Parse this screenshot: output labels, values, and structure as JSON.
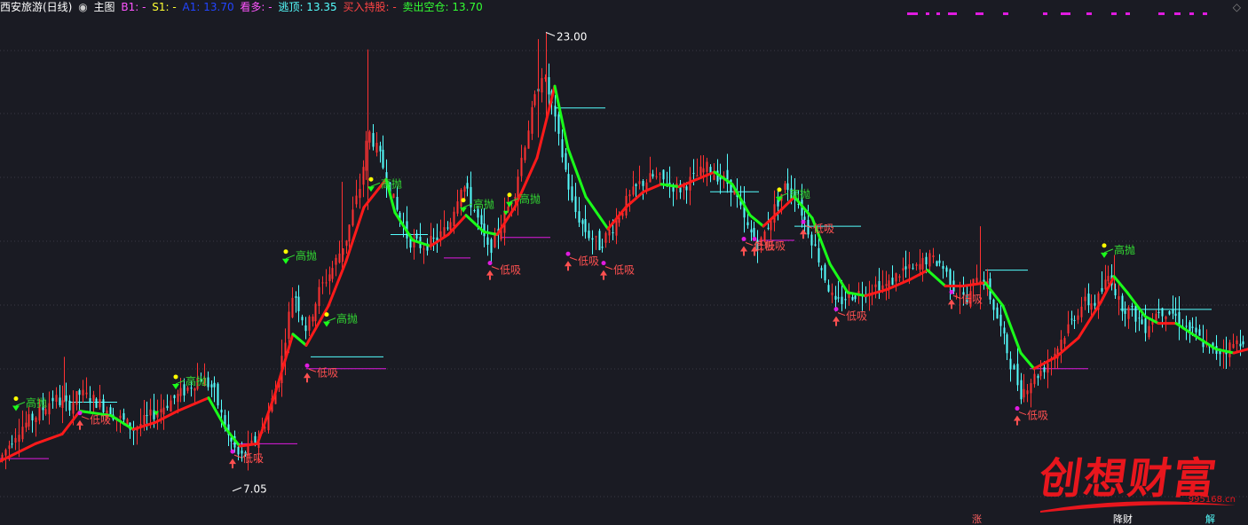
{
  "header": {
    "stock_name": "西安旅游(日线)",
    "main_label": "主图",
    "b1_label": "B1: -",
    "s1_label": "S1: -",
    "a_label": "A1: 13.70",
    "look_up_label": "看多: -",
    "escape_top_label": "逃顶: 13.35",
    "buy_hold_label": "买入持股: -",
    "sell_empty_label": "卖出空仓: 13.70"
  },
  "colors": {
    "background": "#1a1b23",
    "up": "#ff3232",
    "down": "#54ffff",
    "line_up": "#ff1a1a",
    "line_down": "#1aff1a",
    "sell_label": "#33dd33",
    "buy_label": "#ff5050",
    "magenta": "#e01be0",
    "yellow": "#ffff00",
    "grid": "#3a3a44"
  },
  "chart_data": {
    "type": "candlestick",
    "ylim": [
      6.5,
      24.0
    ],
    "y_scale": "log",
    "high_label": "23.00",
    "low_label": "7.05",
    "sell_signal_text": "高抛",
    "buy_signal_text": "低吸",
    "anchors": [
      [
        0,
        7.6
      ],
      [
        20,
        8.2
      ],
      [
        40,
        8.5
      ],
      [
        60,
        8.9
      ],
      [
        75,
        8.7
      ],
      [
        90,
        9.0
      ],
      [
        110,
        8.8
      ],
      [
        130,
        8.5
      ],
      [
        150,
        8.2
      ],
      [
        170,
        8.5
      ],
      [
        190,
        8.8
      ],
      [
        210,
        9.1
      ],
      [
        225,
        9.4
      ],
      [
        240,
        9.1
      ],
      [
        255,
        8.1
      ],
      [
        270,
        7.6
      ],
      [
        285,
        7.9
      ],
      [
        300,
        8.4
      ],
      [
        315,
        9.5
      ],
      [
        330,
        11.8
      ],
      [
        345,
        10.6
      ],
      [
        360,
        11.8
      ],
      [
        375,
        12.5
      ],
      [
        390,
        13.5
      ],
      [
        405,
        15.4
      ],
      [
        415,
        17.8
      ],
      [
        430,
        16.4
      ],
      [
        445,
        14.6
      ],
      [
        460,
        13.4
      ],
      [
        475,
        13.2
      ],
      [
        490,
        13.4
      ],
      [
        505,
        13.9
      ],
      [
        520,
        15.6
      ],
      [
        535,
        14.4
      ],
      [
        550,
        13.0
      ],
      [
        565,
        14.0
      ],
      [
        580,
        15.3
      ],
      [
        595,
        18.0
      ],
      [
        610,
        20.7
      ],
      [
        620,
        19.3
      ],
      [
        630,
        17.2
      ],
      [
        645,
        14.6
      ],
      [
        660,
        13.7
      ],
      [
        675,
        13.2
      ],
      [
        690,
        13.9
      ],
      [
        705,
        14.8
      ],
      [
        720,
        15.5
      ],
      [
        735,
        15.8
      ],
      [
        750,
        15.6
      ],
      [
        765,
        15.3
      ],
      [
        780,
        15.7
      ],
      [
        795,
        16.2
      ],
      [
        810,
        15.8
      ],
      [
        825,
        15.4
      ],
      [
        840,
        13.9
      ],
      [
        855,
        13.2
      ],
      [
        870,
        14.4
      ],
      [
        885,
        15.5
      ],
      [
        895,
        15.1
      ],
      [
        910,
        13.8
      ],
      [
        925,
        12.5
      ],
      [
        940,
        11.3
      ],
      [
        955,
        11.6
      ],
      [
        970,
        11.7
      ],
      [
        985,
        11.9
      ],
      [
        1000,
        11.9
      ],
      [
        1015,
        12.4
      ],
      [
        1030,
        12.4
      ],
      [
        1045,
        12.8
      ],
      [
        1060,
        12.6
      ],
      [
        1075,
        11.8
      ],
      [
        1090,
        11.4
      ],
      [
        1100,
        12.3
      ],
      [
        1110,
        12.0
      ],
      [
        1125,
        10.8
      ],
      [
        1140,
        9.6
      ],
      [
        1150,
        9.0
      ],
      [
        1160,
        9.3
      ],
      [
        1175,
        9.6
      ],
      [
        1190,
        10.1
      ],
      [
        1205,
        10.8
      ],
      [
        1220,
        11.4
      ],
      [
        1235,
        11.4
      ],
      [
        1250,
        12.3
      ],
      [
        1260,
        11.4
      ],
      [
        1275,
        11.1
      ],
      [
        1290,
        10.7
      ],
      [
        1305,
        11.2
      ],
      [
        1320,
        11.1
      ],
      [
        1335,
        10.7
      ],
      [
        1350,
        10.4
      ],
      [
        1365,
        10.0
      ],
      [
        1380,
        10.1
      ],
      [
        1395,
        10.3
      ],
      [
        1406,
        10.5
      ]
    ],
    "trend": [
      [
        0,
        7.55
      ],
      [
        40,
        7.9
      ],
      [
        70,
        8.1
      ],
      [
        90,
        8.6
      ],
      [
        125,
        8.5
      ],
      [
        150,
        8.2
      ],
      [
        175,
        8.35
      ],
      [
        200,
        8.6
      ],
      [
        235,
        8.9
      ],
      [
        255,
        8.2
      ],
      [
        270,
        7.85
      ],
      [
        290,
        7.9
      ],
      [
        310,
        9.0
      ],
      [
        330,
        10.5
      ],
      [
        345,
        10.2
      ],
      [
        370,
        11.3
      ],
      [
        390,
        12.7
      ],
      [
        410,
        14.6
      ],
      [
        435,
        15.7
      ],
      [
        445,
        14.4
      ],
      [
        465,
        13.4
      ],
      [
        485,
        13.2
      ],
      [
        505,
        13.6
      ],
      [
        525,
        14.3
      ],
      [
        545,
        13.7
      ],
      [
        560,
        13.6
      ],
      [
        580,
        14.6
      ],
      [
        605,
        16.6
      ],
      [
        625,
        20.0
      ],
      [
        640,
        17.0
      ],
      [
        660,
        15.0
      ],
      [
        685,
        13.8
      ],
      [
        705,
        14.6
      ],
      [
        725,
        15.2
      ],
      [
        745,
        15.5
      ],
      [
        765,
        15.4
      ],
      [
        785,
        15.7
      ],
      [
        805,
        16.0
      ],
      [
        825,
        15.5
      ],
      [
        845,
        14.3
      ],
      [
        860,
        13.9
      ],
      [
        880,
        14.5
      ],
      [
        895,
        15.0
      ],
      [
        915,
        14.2
      ],
      [
        935,
        12.6
      ],
      [
        955,
        11.7
      ],
      [
        975,
        11.6
      ],
      [
        1000,
        11.8
      ],
      [
        1025,
        12.1
      ],
      [
        1045,
        12.4
      ],
      [
        1065,
        11.9
      ],
      [
        1085,
        11.9
      ],
      [
        1110,
        12.0
      ],
      [
        1130,
        11.3
      ],
      [
        1150,
        10.0
      ],
      [
        1165,
        9.6
      ],
      [
        1190,
        9.9
      ],
      [
        1215,
        10.4
      ],
      [
        1240,
        11.4
      ],
      [
        1255,
        12.2
      ],
      [
        1270,
        11.7
      ],
      [
        1290,
        11.0
      ],
      [
        1305,
        10.8
      ],
      [
        1325,
        10.8
      ],
      [
        1350,
        10.4
      ],
      [
        1370,
        10.1
      ],
      [
        1390,
        10.0
      ],
      [
        1406,
        10.1
      ]
    ],
    "sell_signals": [
      [
        18,
        8.6
      ],
      [
        198,
        9.1
      ],
      [
        322,
        12.6
      ],
      [
        368,
        10.7
      ],
      [
        418,
        15.2
      ],
      [
        522,
        14.4
      ],
      [
        574,
        14.6
      ],
      [
        878,
        14.8
      ],
      [
        1244,
        12.8
      ]
    ],
    "buy_signals": [
      [
        90,
        8.4
      ],
      [
        262,
        7.6
      ],
      [
        346,
        9.5
      ],
      [
        552,
        12.4
      ],
      [
        640,
        12.7
      ],
      [
        680,
        12.4
      ],
      [
        838,
        13.2
      ],
      [
        850,
        13.2
      ],
      [
        905,
        13.8
      ],
      [
        942,
        11.0
      ],
      [
        1072,
        11.5
      ],
      [
        1146,
        8.5
      ]
    ],
    "small_sell_signals": [
      [
        176,
        8.5
      ],
      [
        570,
        14.3
      ]
    ],
    "cyan_levels": [
      [
        78,
        132,
        8.8
      ],
      [
        350,
        432,
        9.9
      ],
      [
        440,
        482,
        13.6
      ],
      [
        625,
        682,
        18.9
      ],
      [
        800,
        855,
        15.2
      ],
      [
        895,
        970,
        13.9
      ],
      [
        1110,
        1158,
        12.4
      ],
      [
        1262,
        1365,
        11.2
      ]
    ],
    "magenta_levels": [
      [
        0,
        55,
        7.6
      ],
      [
        262,
        335,
        7.9
      ],
      [
        345,
        435,
        9.6
      ],
      [
        500,
        530,
        12.8
      ],
      [
        565,
        620,
        13.5
      ],
      [
        855,
        895,
        13.4
      ],
      [
        1160,
        1226,
        9.6
      ]
    ],
    "top_dots": [
      [
        1022,
        1034
      ],
      [
        1043,
        1047
      ],
      [
        1055,
        1059
      ],
      [
        1068,
        1078
      ],
      [
        1099,
        1108
      ],
      [
        1130,
        1136
      ],
      [
        1175,
        1180
      ],
      [
        1195,
        1206
      ],
      [
        1224,
        1230
      ],
      [
        1252,
        1258
      ],
      [
        1268,
        1273
      ],
      [
        1305,
        1312
      ],
      [
        1323,
        1330
      ],
      [
        1340,
        1345
      ],
      [
        1355,
        1360
      ]
    ]
  },
  "watermark": {
    "brand": "创想财富",
    "url": "995168.cn"
  },
  "footer": {
    "label_a": "涨",
    "label_b": "降财",
    "label_c": "解"
  }
}
